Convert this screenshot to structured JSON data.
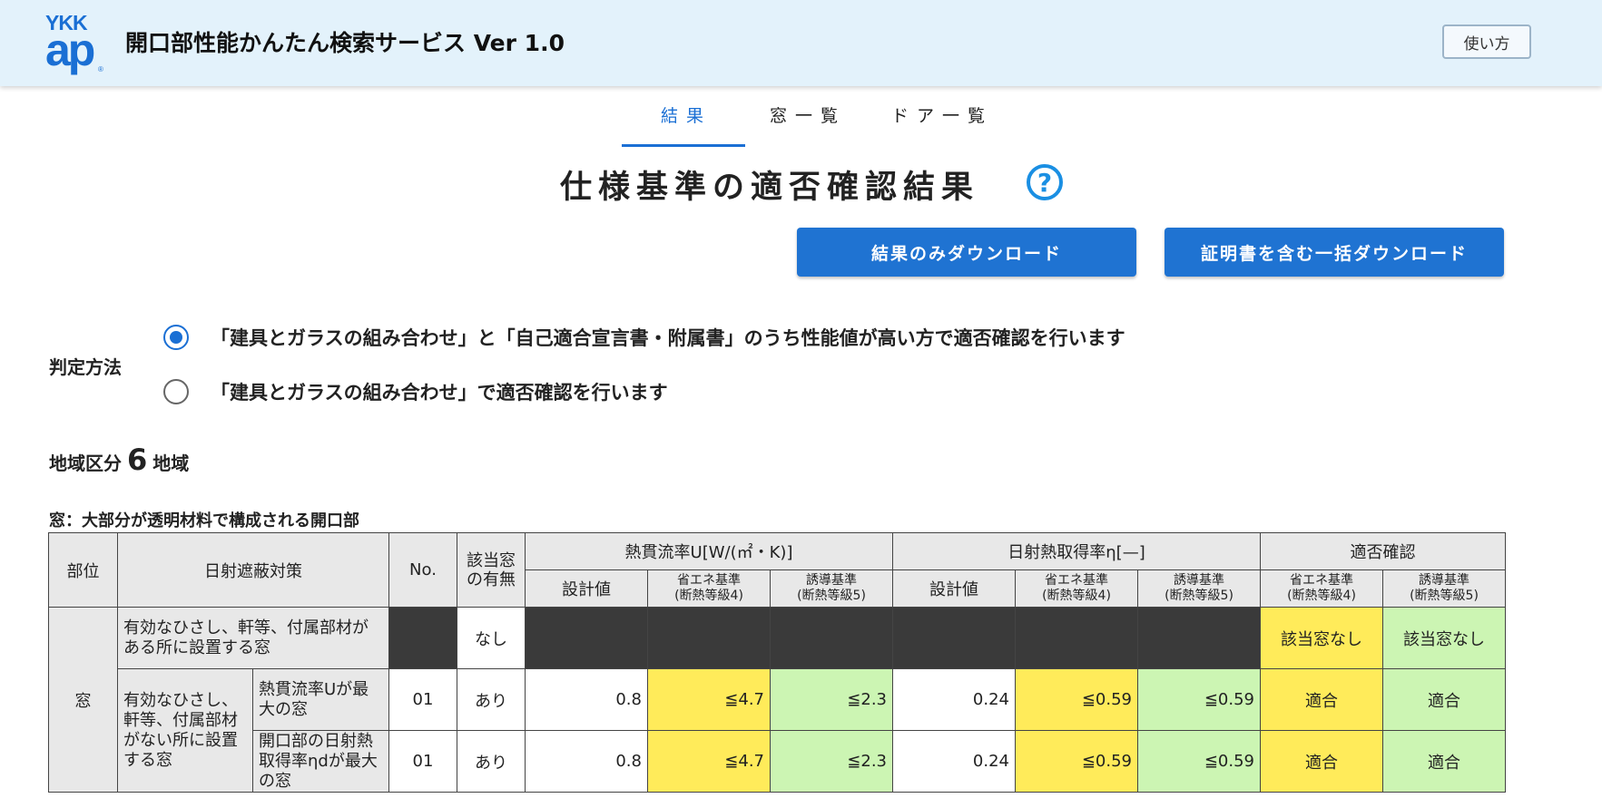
{
  "header": {
    "logo_top": "YKK",
    "logo_bottom": "ap",
    "logo_mark": "®",
    "title": "開口部性能かんたん検索サービス Ver 1.0",
    "help_label": "使い方"
  },
  "tabs": [
    {
      "label": "結果",
      "active": true
    },
    {
      "label": "窓一覧",
      "active": false
    },
    {
      "label": "ドア一覧",
      "active": false
    }
  ],
  "heading": "仕様基準の適否確認結果",
  "help_icon": "?",
  "buttons": {
    "download_results": "結果のみダウンロード",
    "download_all": "証明書を含む一括ダウンロード"
  },
  "method": {
    "label": "判定方法",
    "options": [
      {
        "text": "「建具とガラスの組み合わせ」と「自己適合宣言書・附属書」のうち性能値が高い方で適否確認を行います",
        "checked": true
      },
      {
        "text": "「建具とガラスの組み合わせ」で適否確認を行います",
        "checked": false
      }
    ]
  },
  "region": {
    "prefix": "地域区分",
    "number": "6",
    "suffix": "地域"
  },
  "table_caption": "窓：大部分が透明材料で構成される開口部",
  "table": {
    "headers": {
      "part": "部位",
      "shading": "日射遮蔽対策",
      "no": "No.",
      "applicable": "該当窓の有無",
      "u_group": "熱貫流率U[W/(㎡・K)]",
      "eta_group": "日射熱取得率η[—]",
      "check_group": "適否確認",
      "design": "設計値",
      "energy_std": "省エネ基準",
      "energy_grade": "(断熱等級4)",
      "guide_std": "誘導基準",
      "guide_grade": "(断熱等級5)"
    },
    "part_value": "窓",
    "row1": {
      "shading": "有効なひさし、軒等、付属部材がある所に設置する窓",
      "applicable": "なし",
      "check_energy": "該当窓なし",
      "check_guide": "該当窓なし"
    },
    "group2_label": "有効なひさし、軒等、付属部材がない所に設置する窓",
    "row2": {
      "sub": "熱貫流率Uが最大の窓",
      "no": "01",
      "applicable": "あり",
      "u_design": "0.8",
      "u_energy": "≦4.7",
      "u_guide": "≦2.3",
      "eta_design": "0.24",
      "eta_energy": "≦0.59",
      "eta_guide": "≦0.59",
      "check_energy": "適合",
      "check_guide": "適合"
    },
    "row3": {
      "sub": "開口部の日射熱取得率ηdが最大の窓",
      "no": "01",
      "applicable": "あり",
      "u_design": "0.8",
      "u_energy": "≦4.7",
      "u_guide": "≦2.3",
      "eta_design": "0.24",
      "eta_energy": "≦0.59",
      "eta_guide": "≦0.59",
      "check_energy": "適合",
      "check_guide": "適合"
    }
  },
  "colors": {
    "accent": "#1a6fd4",
    "header_bg": "#e3f2fb",
    "energy_cell": "#ffeb5a",
    "guide_cell": "#ccf5b3",
    "na_cell": "#3a3a3a"
  }
}
